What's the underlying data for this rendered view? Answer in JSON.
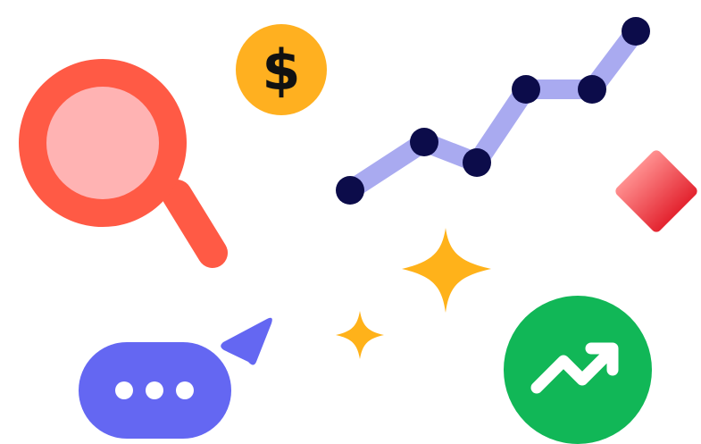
{
  "colors": {
    "background": "#ffffff",
    "magnifier_ring": "#ff5a45",
    "magnifier_lens": "#ffb3b3",
    "coin": "#ffb020",
    "coin_symbol": "#111111",
    "trend_line": "#a9aaf0",
    "trend_points": "#0c0c4a",
    "diamond_start": "#ff8f8f",
    "diamond_end": "#e3232f",
    "sparkle": "#ffb21a",
    "chat_bubble": "#6467f2",
    "chat_dots": "#ffffff",
    "growth_circle": "#11b757",
    "growth_arrow": "#ffffff"
  },
  "icons": {
    "magnifier": "magnifying-glass-icon",
    "coin": "dollar-coin-icon",
    "trend": "line-trend-icon",
    "diamond": "diamond-icon",
    "sparkle_large": "sparkle-large-icon",
    "sparkle_small": "sparkle-small-icon",
    "chat": "chat-bubble-icon",
    "send": "send-arrow-icon",
    "growth": "growth-arrow-icon"
  },
  "coin_symbol": "$"
}
